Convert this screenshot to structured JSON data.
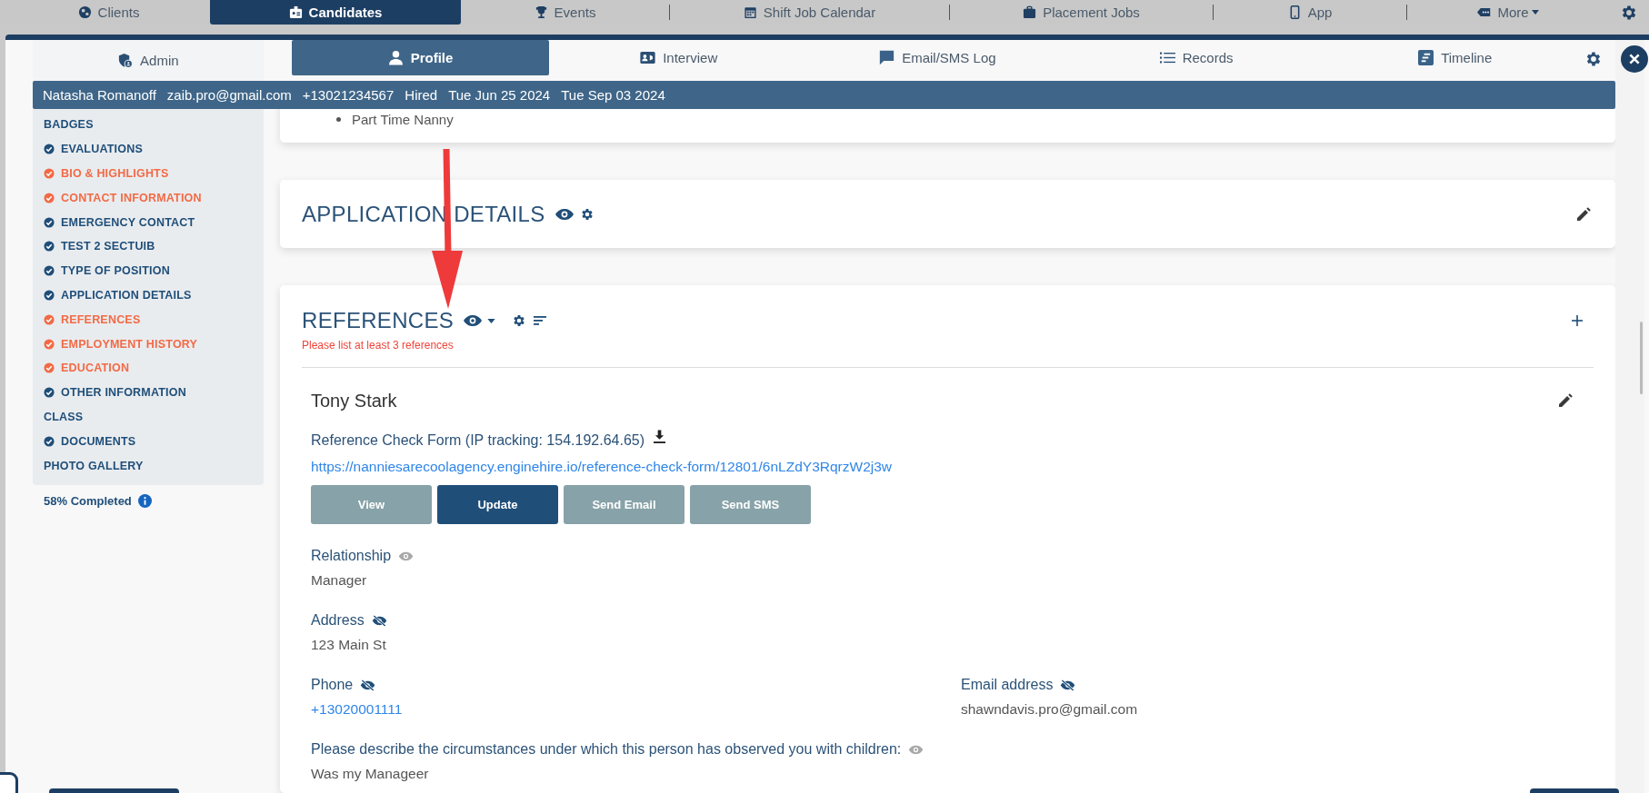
{
  "top_nav": {
    "items": [
      {
        "label": "Clients",
        "selected": false
      },
      {
        "label": "Candidates",
        "selected": true
      },
      {
        "label": "Events",
        "selected": false
      },
      {
        "label": "Shift Job Calendar",
        "selected": false
      },
      {
        "label": "Placement Jobs",
        "selected": false
      },
      {
        "label": "App",
        "selected": false
      },
      {
        "label": "More",
        "selected": false
      }
    ]
  },
  "tabs": [
    {
      "label": "Admin",
      "selected": false
    },
    {
      "label": "Profile",
      "selected": true
    },
    {
      "label": "Interview",
      "selected": false
    },
    {
      "label": "Email/SMS Log",
      "selected": false
    },
    {
      "label": "Records",
      "selected": false
    },
    {
      "label": "Timeline",
      "selected": false
    }
  ],
  "candidate_bar": [
    "Natasha Romanoff",
    "zaib.pro@gmail.com",
    "+13021234567",
    "Hired",
    "Tue Jun 25 2024",
    "Tue Sep 03 2024"
  ],
  "sidebar": {
    "items": [
      {
        "label": "BADGES",
        "kind": "plain"
      },
      {
        "label": "EVALUATIONS",
        "kind": "check",
        "complete": true
      },
      {
        "label": "BIO & HIGHLIGHTS",
        "kind": "check",
        "complete": false
      },
      {
        "label": "CONTACT INFORMATION",
        "kind": "check",
        "complete": false
      },
      {
        "label": "EMERGENCY CONTACT",
        "kind": "check",
        "complete": true
      },
      {
        "label": "TEST 2 SECTUIB",
        "kind": "check",
        "complete": true
      },
      {
        "label": "TYPE OF POSITION",
        "kind": "check",
        "complete": true
      },
      {
        "label": "APPLICATION DETAILS",
        "kind": "check",
        "complete": true
      },
      {
        "label": "REFERENCES",
        "kind": "check",
        "complete": false
      },
      {
        "label": "EMPLOYMENT HISTORY",
        "kind": "check",
        "complete": false
      },
      {
        "label": "EDUCATION",
        "kind": "check",
        "complete": false
      },
      {
        "label": "OTHER INFORMATION",
        "kind": "check",
        "complete": true
      },
      {
        "label": "CLASS",
        "kind": "plain"
      },
      {
        "label": "DOCUMENTS",
        "kind": "check",
        "complete": true
      },
      {
        "label": "PHOTO GALLERY",
        "kind": "plain"
      }
    ],
    "progress": "58% Completed"
  },
  "position_card": {
    "options": [
      "Part Time Nanny"
    ]
  },
  "application_details": {
    "title": "APPLICATION DETAILS"
  },
  "references": {
    "title": "REFERENCES",
    "warning": "Please list at least 3 references",
    "items": [
      {
        "name": "Tony Stark",
        "form_label": "Reference Check Form (IP tracking: 154.192.64.65)",
        "form_link": "https://nanniesarecoolagency.enginehire.io/reference-check-form/12801/6nLZdY3RqrzW2j3w",
        "buttons": [
          {
            "label": "View",
            "primary": false
          },
          {
            "label": "Update",
            "primary": true
          },
          {
            "label": "Send Email",
            "primary": false
          },
          {
            "label": "Send SMS",
            "primary": false
          }
        ],
        "rows": [
          [
            {
              "label": "Relationship",
              "hidden": false,
              "value": "Manager",
              "kind": "text"
            }
          ],
          [
            {
              "label": "Address",
              "hidden": true,
              "value": "123 Main St",
              "kind": "text"
            }
          ],
          [
            {
              "label": "Phone",
              "hidden": true,
              "value": "+13020001111",
              "kind": "link"
            },
            {
              "label": "Email address",
              "hidden": true,
              "value": "shawndavis.pro@gmail.com",
              "kind": "text"
            }
          ],
          [
            {
              "label": "Please describe the circumstances under which this person has observed you with children:",
              "hidden": false,
              "value": "Was my Manageer",
              "kind": "text"
            }
          ]
        ]
      }
    ]
  }
}
